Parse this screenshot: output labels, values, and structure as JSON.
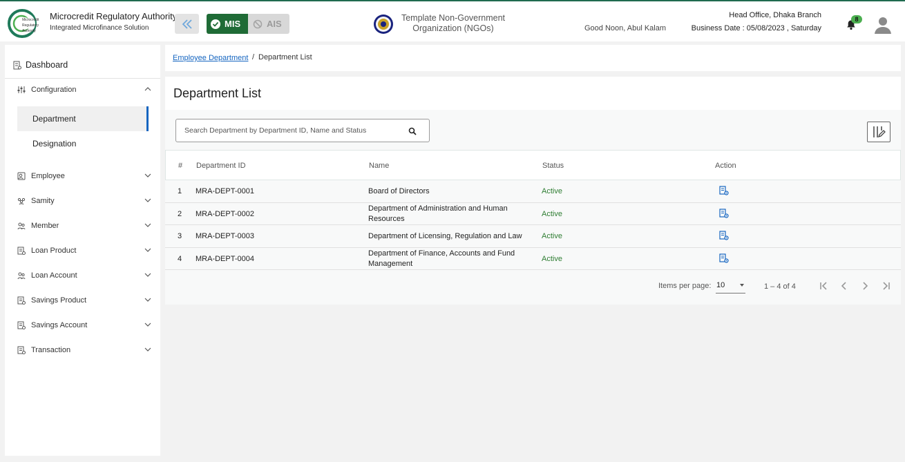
{
  "header": {
    "brand_title": "Microcredit Regulatory Authority",
    "brand_subtitle": "Integrated Microfinance Solution",
    "logo_text": "Microcredit Regulatory Authority",
    "mis_label": "MIS",
    "ais_label": "AIS",
    "org_name": "Template Non-Government Organization (NGOs)",
    "greeting": "Good Noon, Abul Kalam",
    "branch": "Head Office, Dhaka Branch",
    "business_date": "Business Date : 05/08/2023 , Saturday",
    "notification_count": "8"
  },
  "sidebar": {
    "dashboard": "Dashboard",
    "configuration": "Configuration",
    "sub_items": [
      "Department",
      "Designation"
    ],
    "items": [
      "Employee",
      "Samity",
      "Member",
      "Loan Product",
      "Loan Account",
      "Savings Product",
      "Savings Account",
      "Transaction"
    ]
  },
  "breadcrumb": {
    "parent": "Employee Department",
    "separator": "/",
    "current": "Department List"
  },
  "page": {
    "title": "Department List",
    "search_placeholder": "Search Department by Department ID, Name and Status"
  },
  "table": {
    "headers": [
      "#",
      "Department ID",
      "Name",
      "Status",
      "Action"
    ],
    "rows": [
      {
        "num": "1",
        "id": "MRA-DEPT-0001",
        "name": "Board of Directors",
        "status": "Active"
      },
      {
        "num": "2",
        "id": "MRA-DEPT-0002",
        "name": "Department of Administration and Human Resources",
        "status": "Active"
      },
      {
        "num": "3",
        "id": "MRA-DEPT-0003",
        "name": "Department of Licensing, Regulation and Law",
        "status": "Active"
      },
      {
        "num": "4",
        "id": "MRA-DEPT-0004",
        "name": "Department of Finance, Accounts and Fund Management",
        "status": "Active"
      }
    ]
  },
  "pagination": {
    "items_per_page_label": "Items per page:",
    "items_per_page": "10",
    "range": "1 – 4 of 4"
  },
  "colors": {
    "accent": "#1565c0",
    "mis_green": "#1f6b36",
    "status_active": "#2e7d32",
    "top_bar": "#1f6b4f"
  }
}
